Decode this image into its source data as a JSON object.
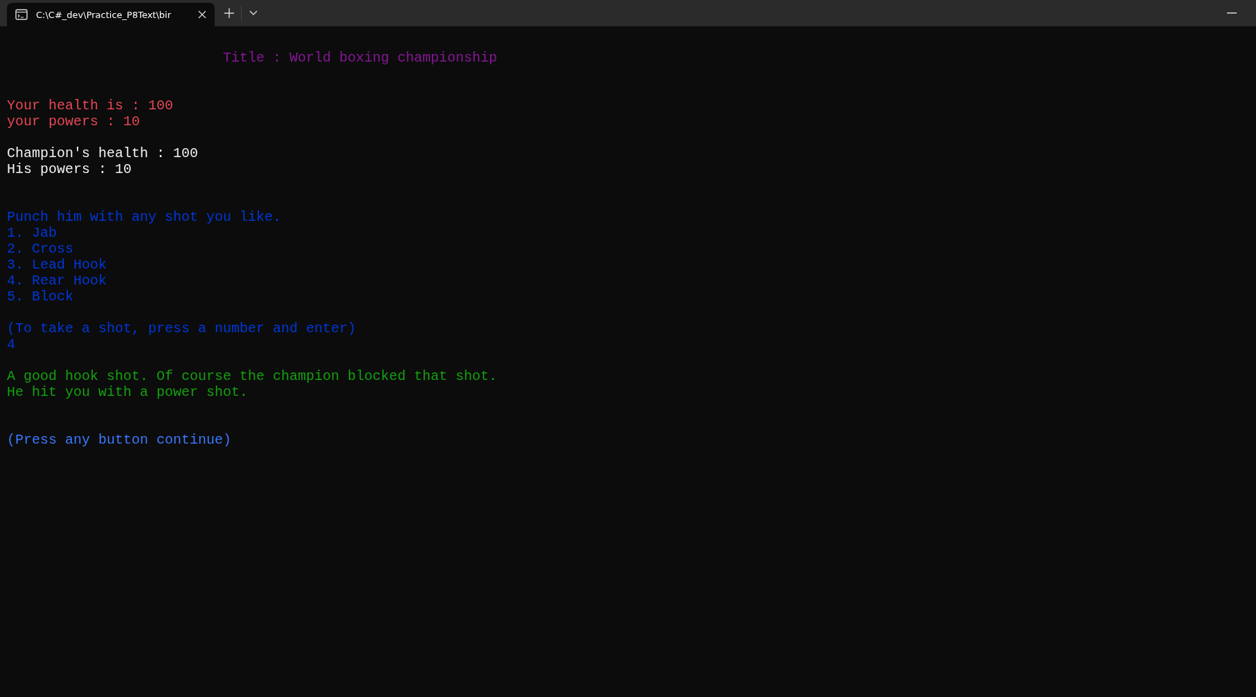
{
  "tab": {
    "title": "C:\\C#_dev\\Practice_P8Text\\bir",
    "selected": true
  },
  "console": {
    "lines": [
      {
        "kind": "title",
        "text": "Title : World boxing championship",
        "color": "#881798"
      },
      {
        "kind": "blank"
      },
      {
        "kind": "blank"
      },
      {
        "kind": "text",
        "text": "Your health is : 100",
        "color": "#e74856"
      },
      {
        "kind": "text",
        "text": "your powers : 10",
        "color": "#e74856"
      },
      {
        "kind": "blank"
      },
      {
        "kind": "text",
        "text": "Champion's health : 100",
        "color": "#f2f2f2"
      },
      {
        "kind": "text",
        "text": "His powers : 10",
        "color": "#f2f2f2"
      },
      {
        "kind": "blank"
      },
      {
        "kind": "blank"
      },
      {
        "kind": "text",
        "text": "Punch him with any shot you like.",
        "color": "#0037da"
      },
      {
        "kind": "text",
        "text": "1. Jab",
        "color": "#0037da"
      },
      {
        "kind": "text",
        "text": "2. Cross",
        "color": "#0037da"
      },
      {
        "kind": "text",
        "text": "3. Lead Hook",
        "color": "#0037da"
      },
      {
        "kind": "text",
        "text": "4. Rear Hook",
        "color": "#0037da"
      },
      {
        "kind": "text",
        "text": "5. Block",
        "color": "#0037da"
      },
      {
        "kind": "blank"
      },
      {
        "kind": "text",
        "text": "(To take a shot, press a number and enter)",
        "color": "#0037da"
      },
      {
        "kind": "input",
        "text": "4",
        "color": "#0037da"
      },
      {
        "kind": "blank"
      },
      {
        "kind": "text",
        "text": "A good hook shot. Of course the champion blocked that shot.",
        "color": "#13a10e"
      },
      {
        "kind": "text",
        "text": "He hit you with a power shot.",
        "color": "#13a10e"
      },
      {
        "kind": "blank"
      },
      {
        "kind": "blank"
      },
      {
        "kind": "text",
        "text": "(Press any button continue)",
        "color": "#3b78ff"
      }
    ]
  }
}
